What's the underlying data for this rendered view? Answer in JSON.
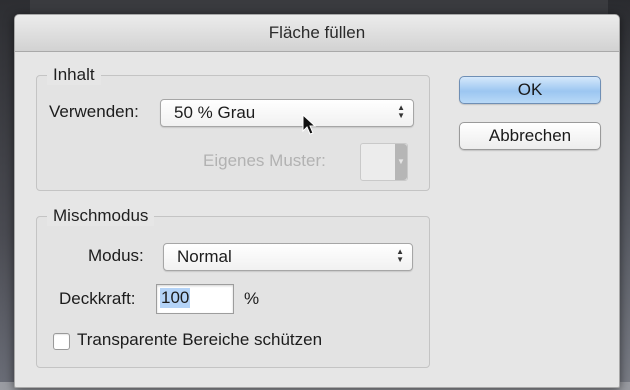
{
  "dialog": {
    "title": "Fläche füllen"
  },
  "inhalt": {
    "legend": "Inhalt",
    "verwenden_label": "Verwenden:",
    "verwenden_value": "50 % Grau",
    "eigenes_muster_label": "Eigenes Muster:"
  },
  "mischmodus": {
    "legend": "Mischmodus",
    "modus_label": "Modus:",
    "modus_value": "Normal",
    "deckkraft_label": "Deckkraft:",
    "deckkraft_value": "100",
    "deckkraft_unit": "%",
    "transparent_label": "Transparente Bereiche schützen",
    "transparent_checked": false
  },
  "buttons": {
    "ok": "OK",
    "cancel": "Abbrechen"
  },
  "colors": {
    "default_button": "#9cc6f1",
    "dialog_bg": "#e6e6e6"
  }
}
